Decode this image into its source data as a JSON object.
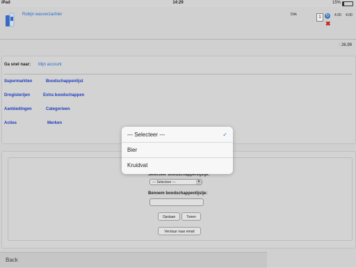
{
  "status_bar": {
    "carrier": "iPad",
    "time": "14:29",
    "battery": "15%"
  },
  "product": {
    "name": "Robijn wasverzachter",
    "store": "Dirk",
    "quantity": "1",
    "price_unit": "4.00",
    "price_total": "4.00"
  },
  "total": ": 26,99",
  "nav": {
    "goto_label": "Ga snel naar:",
    "account_link": "Mijn account",
    "links": [
      {
        "label": "Supermarkten"
      },
      {
        "label": "Boodschappenlijst"
      },
      {
        "label": "Drogisterijen"
      },
      {
        "label": "Extra boodschappen"
      },
      {
        "label": "Aanbiedingen"
      },
      {
        "label": "Categorieen"
      },
      {
        "label": "Acties"
      },
      {
        "label": "Merken"
      }
    ]
  },
  "form": {
    "select_label": "Selecteer boodschappenlijstje:",
    "select_value": "--- Selecteer ---",
    "name_label": "Benoem boodschappenlijstje:",
    "save_label": "Opslaan",
    "show_label": "Tonen",
    "email_label": "Verstuur naar email"
  },
  "back_label": "Back",
  "dropdown": {
    "options": [
      "--- Selecteer ---",
      "Bier",
      "Kruidvat"
    ],
    "selected_index": 0
  },
  "colors": {
    "link": "#2a6fd6",
    "link_bold": "#1e3ec8",
    "delete": "#d02020",
    "check": "#2a7ad6"
  }
}
